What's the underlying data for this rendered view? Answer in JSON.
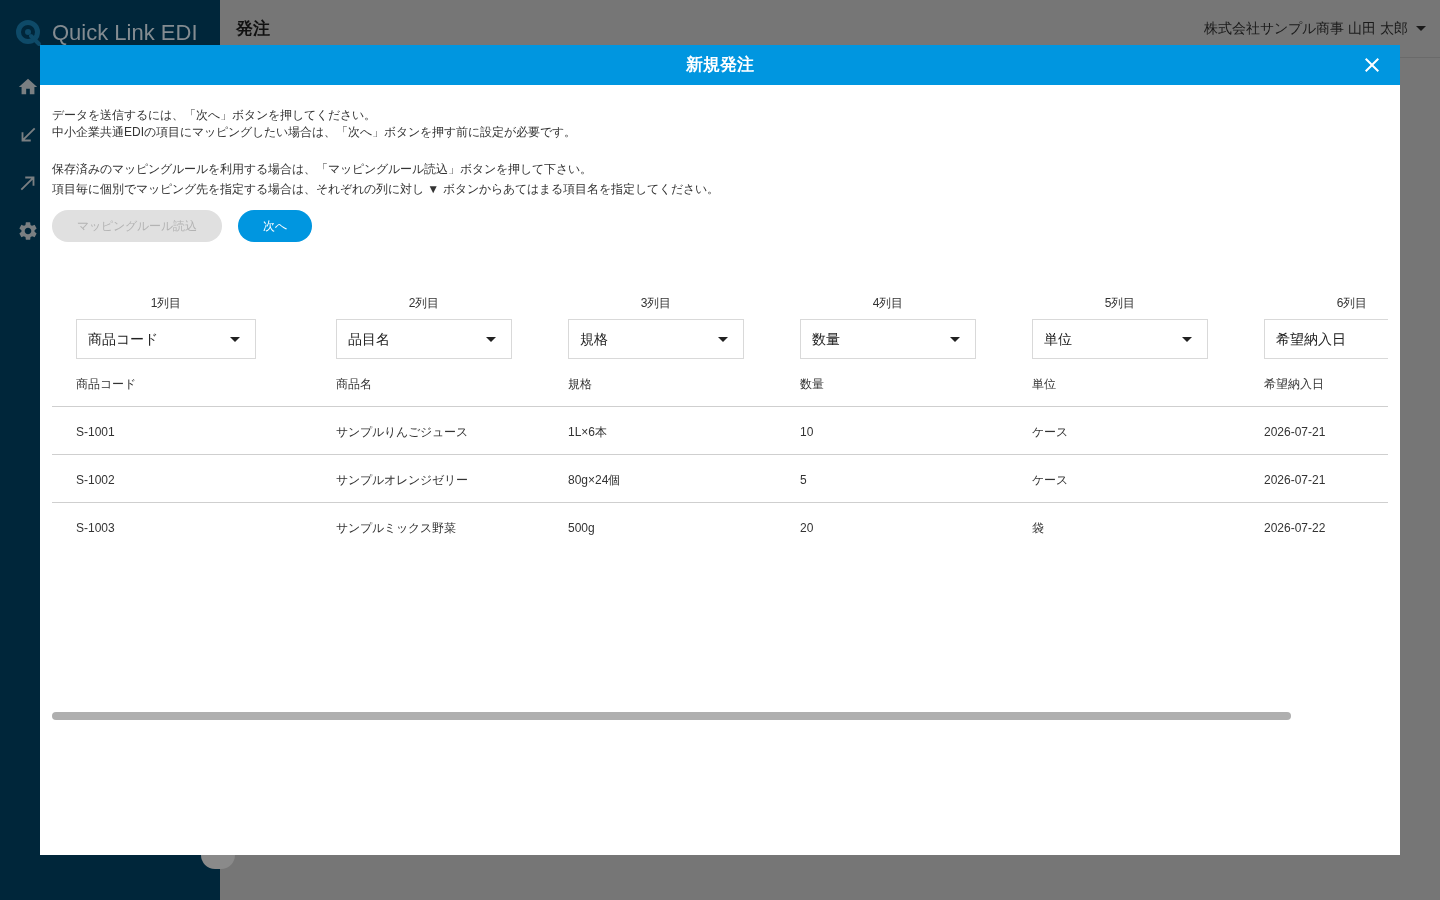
{
  "sidebar": {
    "logo": "Quick Link EDI"
  },
  "header": {
    "title": "発注",
    "user": "株式会社サンプル商事 山田 太郎"
  },
  "dialog": {
    "title": "新規発注",
    "instructions": [
      [
        "データを送信するには、「次へ」ボタンを押してください。",
        "中小企業共通EDIの項目にマッピングしたい場合は、「次へ」ボタンを押す前に設定が必要です。"
      ],
      [
        "保存済みのマッピングルールを利用する場合は、「マッピングルール読込」ボタンを押して下さい。",
        "項目毎に個別でマッピング先を指定する場合は、それぞれの列に対し ▼ ボタンからあてはまる項目名を指定してください。"
      ]
    ],
    "buttons": [
      {
        "label": "マッピングルール読込",
        "disabled": true
      },
      {
        "label": "次へ",
        "disabled": false
      }
    ],
    "columns": [
      {
        "label": "1列目",
        "mapping": "商品コード",
        "header": "商品コード"
      },
      {
        "label": "2列目",
        "mapping": "品目名",
        "header": "商品名"
      },
      {
        "label": "3列目",
        "mapping": "規格",
        "header": "規格"
      },
      {
        "label": "4列目",
        "mapping": "数量",
        "header": "数量"
      },
      {
        "label": "5列目",
        "mapping": "単位",
        "header": "単位"
      },
      {
        "label": "6列目",
        "mapping": "希望納入日",
        "header": "希望納入日"
      }
    ],
    "rows": [
      [
        "S-1001",
        "サンプルりんごジュース",
        "1L×6本",
        "10",
        "ケース",
        "2026-07-21"
      ],
      [
        "S-1002",
        "サンプルオレンジゼリー",
        "80g×24個",
        "5",
        "ケース",
        "2026-07-21"
      ],
      [
        "S-1003",
        "サンプルミックス野菜",
        "500g",
        "20",
        "袋",
        "2026-07-22"
      ]
    ]
  }
}
